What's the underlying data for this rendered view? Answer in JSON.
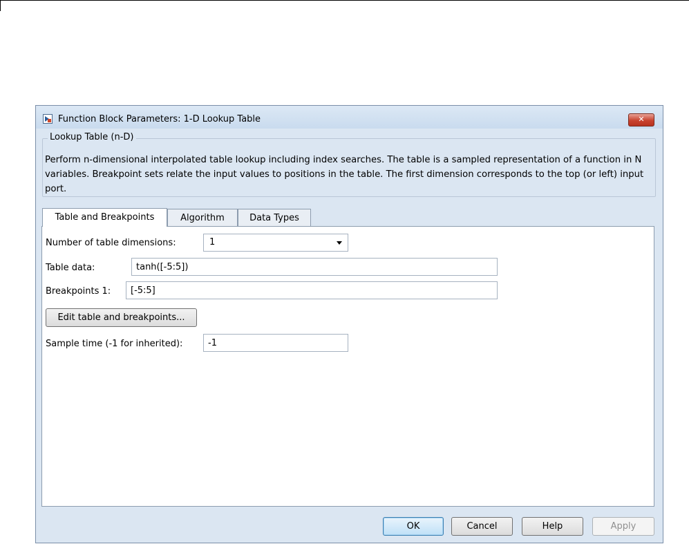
{
  "window": {
    "title": "Function Block Parameters: 1-D Lookup Table",
    "close_icon": "close-x-icon"
  },
  "block": {
    "name": "Lookup Table (n-D)",
    "description": "Perform n-dimensional interpolated table lookup including index searches. The table is a sampled representation of a function in N variables. Breakpoint sets relate the input values to positions in the table. The first dimension corresponds to the top (or left) input port."
  },
  "tabs": [
    {
      "label": "Table and Breakpoints",
      "active": true
    },
    {
      "label": "Algorithm",
      "active": false
    },
    {
      "label": "Data Types",
      "active": false
    }
  ],
  "params": {
    "dimensions_label": "Number of table dimensions:",
    "dimensions_value": "1",
    "table_data_label": "Table data:",
    "table_data_value": "tanh([-5:5])",
    "breakpoints_label": "Breakpoints 1:",
    "breakpoints_value": "[-5:5]",
    "edit_button": "Edit table and breakpoints...",
    "sample_time_label": "Sample time (-1 for inherited):",
    "sample_time_value": "-1"
  },
  "buttons": {
    "ok": "OK",
    "cancel": "Cancel",
    "help": "Help",
    "apply": "Apply"
  },
  "colors": {
    "dialog_background": "#dbe6f2",
    "close_button": "#c8432f"
  }
}
